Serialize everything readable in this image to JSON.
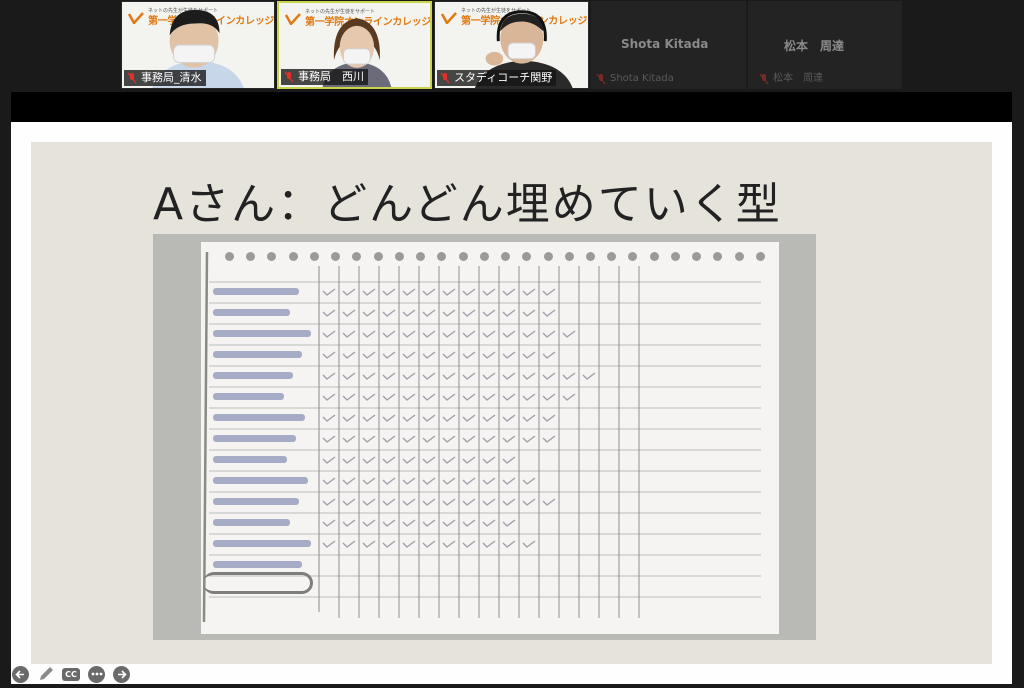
{
  "participants": [
    {
      "name": "事務局_清水",
      "banner_small": "ネットの先生が生徒をサポート",
      "banner_big": "第一学院オンラインカレッジ",
      "hair": "#1c1c1c",
      "top": "#c8d6ea"
    },
    {
      "name": "事務局　西川",
      "banner_small": "ネットの先生が生徒をサポート",
      "banner_big": "第一学院オンラインカレッジ",
      "hair": "#5a3b22",
      "top": "#6b6b7a"
    },
    {
      "name": "スタディコーチ関野",
      "banner_small": "ネットの先生が生徒をサポート",
      "banner_big": "第一学院オンラインカレッジ",
      "hair": "#222",
      "top": "#2a2a2a"
    },
    {
      "name": "Shota Kitada",
      "label": "Shota Kitada"
    },
    {
      "name": "松本　周達",
      "label": "松本　周達"
    }
  ],
  "slide": {
    "title": "Aさん：どんどん埋めていく型"
  },
  "toolbar": {
    "cc_label": "CC"
  },
  "colors": {
    "brand_orange": "#e07a12",
    "active_speaker": "#c9d44a",
    "mic_muted": "#e0302a"
  }
}
